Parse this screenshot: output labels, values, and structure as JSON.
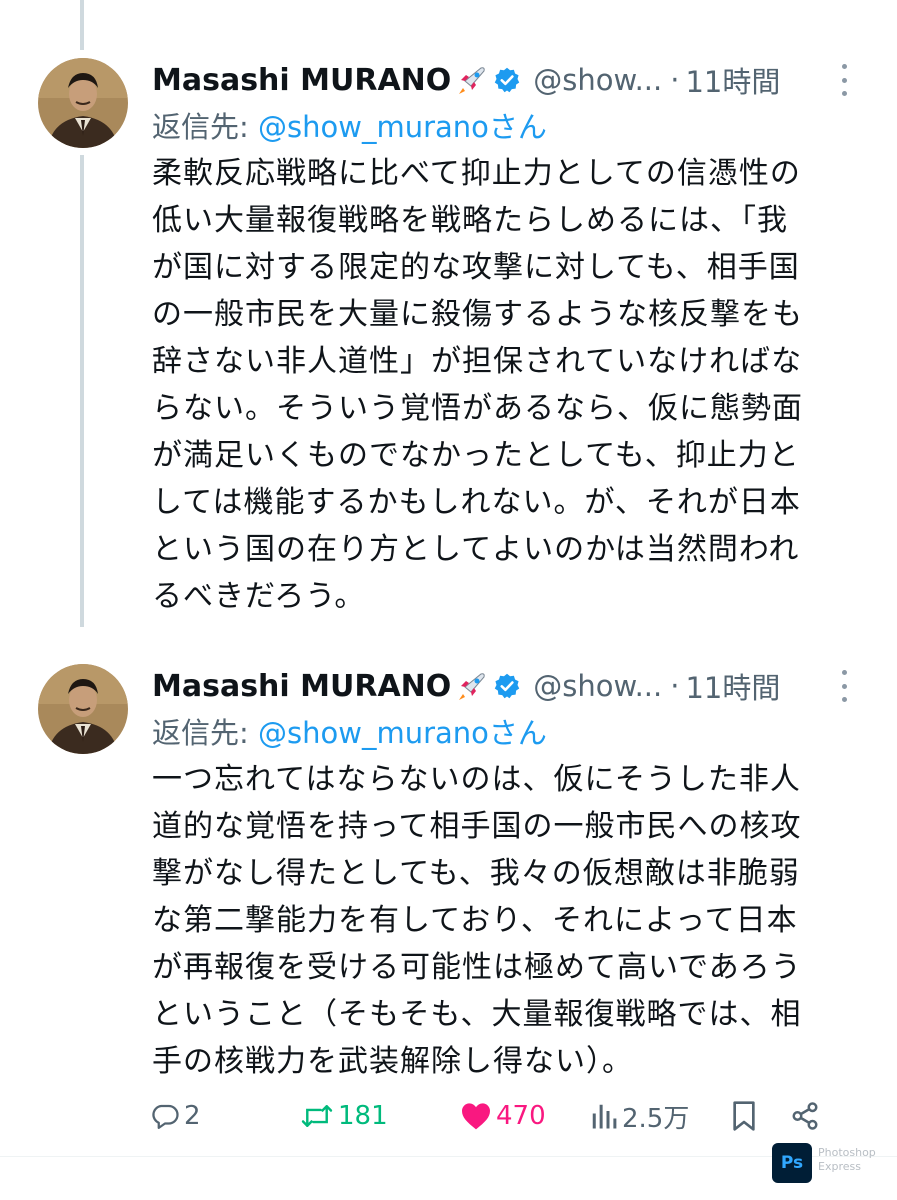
{
  "thread": [
    {
      "author": {
        "name": "Masashi MURANO",
        "handle": "@show...",
        "time": "11時間"
      },
      "reply_to": {
        "prefix": "返信先: ",
        "mention": "@show_murano",
        "suffix": "さん"
      },
      "lines": [
        "柔軟反応戦略に比べて抑止力としての信憑性の",
        "低い大量報復戦略を戦略たらしめるには、「我",
        "が国に対する限定的な攻撃に対しても、相手国",
        "の一般市民を大量に殺傷するような核反撃をも",
        "辞さない非人道性」が担保されていなければな",
        "らない。そういう覚悟があるなら、仮に態勢面",
        "が満足いくものでなかったとしても、抑止力と",
        "しては機能するかもしれない。が、それが日本",
        "という国の在り方としてよいのかは当然問われ",
        "るべきだろう。"
      ]
    },
    {
      "author": {
        "name": "Masashi MURANO",
        "handle": "@show...",
        "time": "11時間"
      },
      "reply_to": {
        "prefix": "返信先: ",
        "mention": "@show_murano",
        "suffix": "さん"
      },
      "lines": [
        "一つ忘れてはならないのは、仮にそうした非人",
        "道的な覚悟を持って相手国の一般市民への核攻",
        "撃がなし得たとしても、我々の仮想敵は非脆弱",
        "な第二撃能力を有しており、それによって日本",
        "が再報復を受ける可能性は極めて高いであろう",
        "ということ（そもそも、大量報復戦略では、相",
        "手の核戦力を武装解除し得ない）。"
      ]
    }
  ],
  "actions": {
    "replies": "2",
    "retweets": "181",
    "likes": "470",
    "views": "2.5万"
  },
  "watermark": {
    "badge": "Ps",
    "label": "Photoshop Express"
  },
  "colors": {
    "accent": "#1d9bf0",
    "retweet": "#00ba7c",
    "like": "#f91880",
    "muted": "#536471"
  }
}
